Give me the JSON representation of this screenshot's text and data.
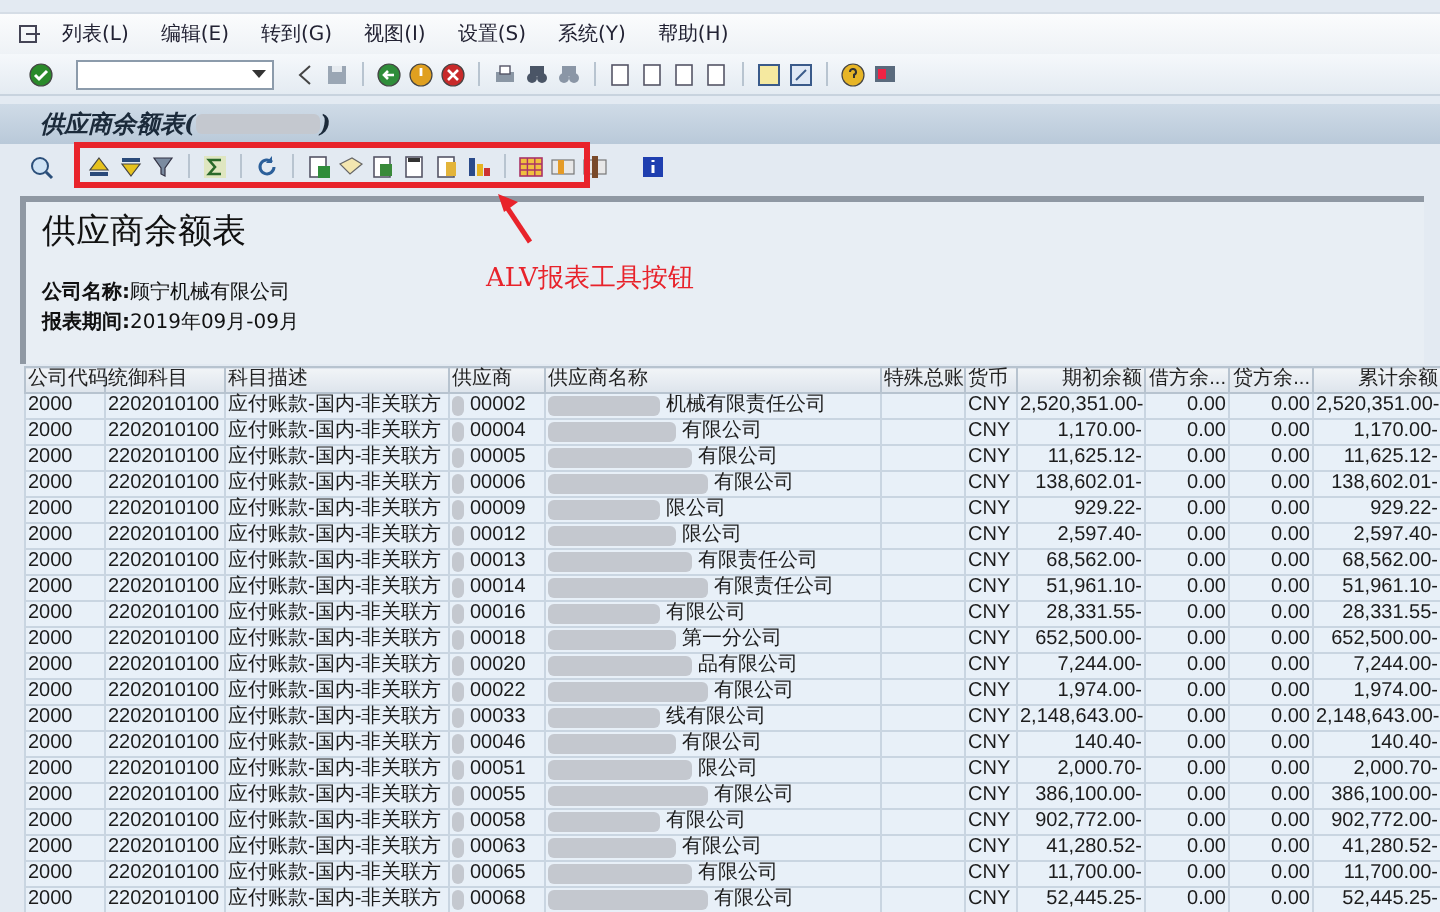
{
  "menu": [
    "列表(L)",
    "编辑(E)",
    "转到(G)",
    "视图(I)",
    "设置(S)",
    "系统(Y)",
    "帮助(H)"
  ],
  "report_title": {
    "text": "供应商余额表(",
    "closing": ")"
  },
  "header": {
    "heading": "供应商余额表",
    "lines": [
      "**公司名称:**顾宁机械有限公司",
      "**报表期间:**2019年09月-09月"
    ]
  },
  "annotation": "ALV报表工具按钮",
  "table": {
    "columns": [
      "公司代码",
      "统御科目",
      "科目描述",
      "供应商",
      "供应商名称",
      "特殊总账",
      "货币",
      "期初余额",
      "借方余...",
      "贷方余...",
      "累计余额"
    ],
    "rows": [
      [
        "2000",
        "2202010100",
        "应付账款-国内-非关联方",
        "00002",
        "机械有限责任公司",
        "",
        "CNY",
        "2,520,351.00-",
        "0.00",
        "0.00",
        "2,520,351.00-"
      ],
      [
        "2000",
        "2202010100",
        "应付账款-国内-非关联方",
        "00004",
        "有限公司",
        "",
        "CNY",
        "1,170.00-",
        "0.00",
        "0.00",
        "1,170.00-"
      ],
      [
        "2000",
        "2202010100",
        "应付账款-国内-非关联方",
        "00005",
        "有限公司",
        "",
        "CNY",
        "11,625.12-",
        "0.00",
        "0.00",
        "11,625.12-"
      ],
      [
        "2000",
        "2202010100",
        "应付账款-国内-非关联方",
        "00006",
        "有限公司",
        "",
        "CNY",
        "138,602.01-",
        "0.00",
        "0.00",
        "138,602.01-"
      ],
      [
        "2000",
        "2202010100",
        "应付账款-国内-非关联方",
        "00009",
        "限公司",
        "",
        "CNY",
        "929.22-",
        "0.00",
        "0.00",
        "929.22-"
      ],
      [
        "2000",
        "2202010100",
        "应付账款-国内-非关联方",
        "00012",
        "限公司",
        "",
        "CNY",
        "2,597.40-",
        "0.00",
        "0.00",
        "2,597.40-"
      ],
      [
        "2000",
        "2202010100",
        "应付账款-国内-非关联方",
        "00013",
        "有限责任公司",
        "",
        "CNY",
        "68,562.00-",
        "0.00",
        "0.00",
        "68,562.00-"
      ],
      [
        "2000",
        "2202010100",
        "应付账款-国内-非关联方",
        "00014",
        "有限责任公司",
        "",
        "CNY",
        "51,961.10-",
        "0.00",
        "0.00",
        "51,961.10-"
      ],
      [
        "2000",
        "2202010100",
        "应付账款-国内-非关联方",
        "00016",
        "有限公司",
        "",
        "CNY",
        "28,331.55-",
        "0.00",
        "0.00",
        "28,331.55-"
      ],
      [
        "2000",
        "2202010100",
        "应付账款-国内-非关联方",
        "00018",
        "第一分公司",
        "",
        "CNY",
        "652,500.00-",
        "0.00",
        "0.00",
        "652,500.00-"
      ],
      [
        "2000",
        "2202010100",
        "应付账款-国内-非关联方",
        "00020",
        "品有限公司",
        "",
        "CNY",
        "7,244.00-",
        "0.00",
        "0.00",
        "7,244.00-"
      ],
      [
        "2000",
        "2202010100",
        "应付账款-国内-非关联方",
        "00022",
        "有限公司",
        "",
        "CNY",
        "1,974.00-",
        "0.00",
        "0.00",
        "1,974.00-"
      ],
      [
        "2000",
        "2202010100",
        "应付账款-国内-非关联方",
        "00033",
        "线有限公司",
        "",
        "CNY",
        "2,148,643.00-",
        "0.00",
        "0.00",
        "2,148,643.00-"
      ],
      [
        "2000",
        "2202010100",
        "应付账款-国内-非关联方",
        "00046",
        "有限公司",
        "",
        "CNY",
        "140.40-",
        "0.00",
        "0.00",
        "140.40-"
      ],
      [
        "2000",
        "2202010100",
        "应付账款-国内-非关联方",
        "00051",
        "限公司",
        "",
        "CNY",
        "2,000.70-",
        "0.00",
        "0.00",
        "2,000.70-"
      ],
      [
        "2000",
        "2202010100",
        "应付账款-国内-非关联方",
        "00055",
        "有限公司",
        "",
        "CNY",
        "386,100.00-",
        "0.00",
        "0.00",
        "386,100.00-"
      ],
      [
        "2000",
        "2202010100",
        "应付账款-国内-非关联方",
        "00058",
        "有限公司",
        "",
        "CNY",
        "902,772.00-",
        "0.00",
        "0.00",
        "902,772.00-"
      ],
      [
        "2000",
        "2202010100",
        "应付账款-国内-非关联方",
        "00063",
        "有限公司",
        "",
        "CNY",
        "41,280.52-",
        "0.00",
        "0.00",
        "41,280.52-"
      ],
      [
        "2000",
        "2202010100",
        "应付账款-国内-非关联方",
        "00065",
        "有限公司",
        "",
        "CNY",
        "11,700.00-",
        "0.00",
        "0.00",
        "11,700.00-"
      ],
      [
        "2000",
        "2202010100",
        "应付账款-国内-非关联方",
        "00068",
        "有限公司",
        "",
        "CNY",
        "52,445.25-",
        "0.00",
        "0.00",
        "52,445.25-"
      ]
    ]
  }
}
